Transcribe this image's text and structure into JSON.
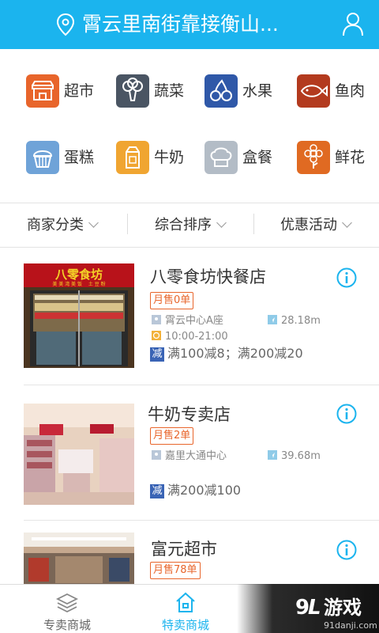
{
  "header": {
    "title": "霄云里南街靠接衡山...",
    "location_icon": "map-pin-icon",
    "user_icon": "user-icon",
    "background_color": "#1bb4ee"
  },
  "categories": [
    {
      "label": "超市",
      "icon": "storefront-icon",
      "color": "#e8652b"
    },
    {
      "label": "蔬菜",
      "icon": "broccoli-icon",
      "color": "#4a5563"
    },
    {
      "label": "水果",
      "icon": "cherry-icon",
      "color": "#2f58a8"
    },
    {
      "label": "鱼肉",
      "icon": "fish-icon",
      "color": "#b33a1e"
    },
    {
      "label": "蛋糕",
      "icon": "cupcake-icon",
      "color": "#6fa3d8"
    },
    {
      "label": "牛奶",
      "icon": "milk-carton-icon",
      "color": "#f0a531"
    },
    {
      "label": "盒餐",
      "icon": "chef-hat-icon",
      "color": "#b3bcc6"
    },
    {
      "label": "鲜花",
      "icon": "flower-icon",
      "color": "#e06a22"
    }
  ],
  "filters": [
    {
      "label": "商家分类"
    },
    {
      "label": "综合排序"
    },
    {
      "label": "优惠活动"
    }
  ],
  "shops": [
    {
      "name": "八零食坊快餐店",
      "sign_text": "八零食坊",
      "sign_sub": "美 美 湾 美 饭　 土 豆 粉",
      "monthly_sales": "月售0单",
      "address": "霄云中心A座",
      "distance": "28.18m",
      "hours": "10:00-21:00",
      "promo_tag": "减",
      "promo": "满100减8；满200减20"
    },
    {
      "name": "牛奶专卖店",
      "monthly_sales": "月售2单",
      "address": "嘉里大通中心",
      "distance": "39.68m",
      "promo_tag": "减",
      "promo": "满200减100"
    },
    {
      "name": "富元超市",
      "monthly_sales": "月售78单"
    }
  ],
  "tabbar": [
    {
      "label": "专卖商城",
      "icon": "layers-icon",
      "active": false
    },
    {
      "label": "特卖商城",
      "icon": "home-icon",
      "active": true
    }
  ],
  "watermark": {
    "brand": "游戏",
    "site": "91danji.com"
  },
  "colors": {
    "accent": "#1bb4ee",
    "sales_badge": "#e8652b",
    "promo_tag": "#3a64b5"
  }
}
